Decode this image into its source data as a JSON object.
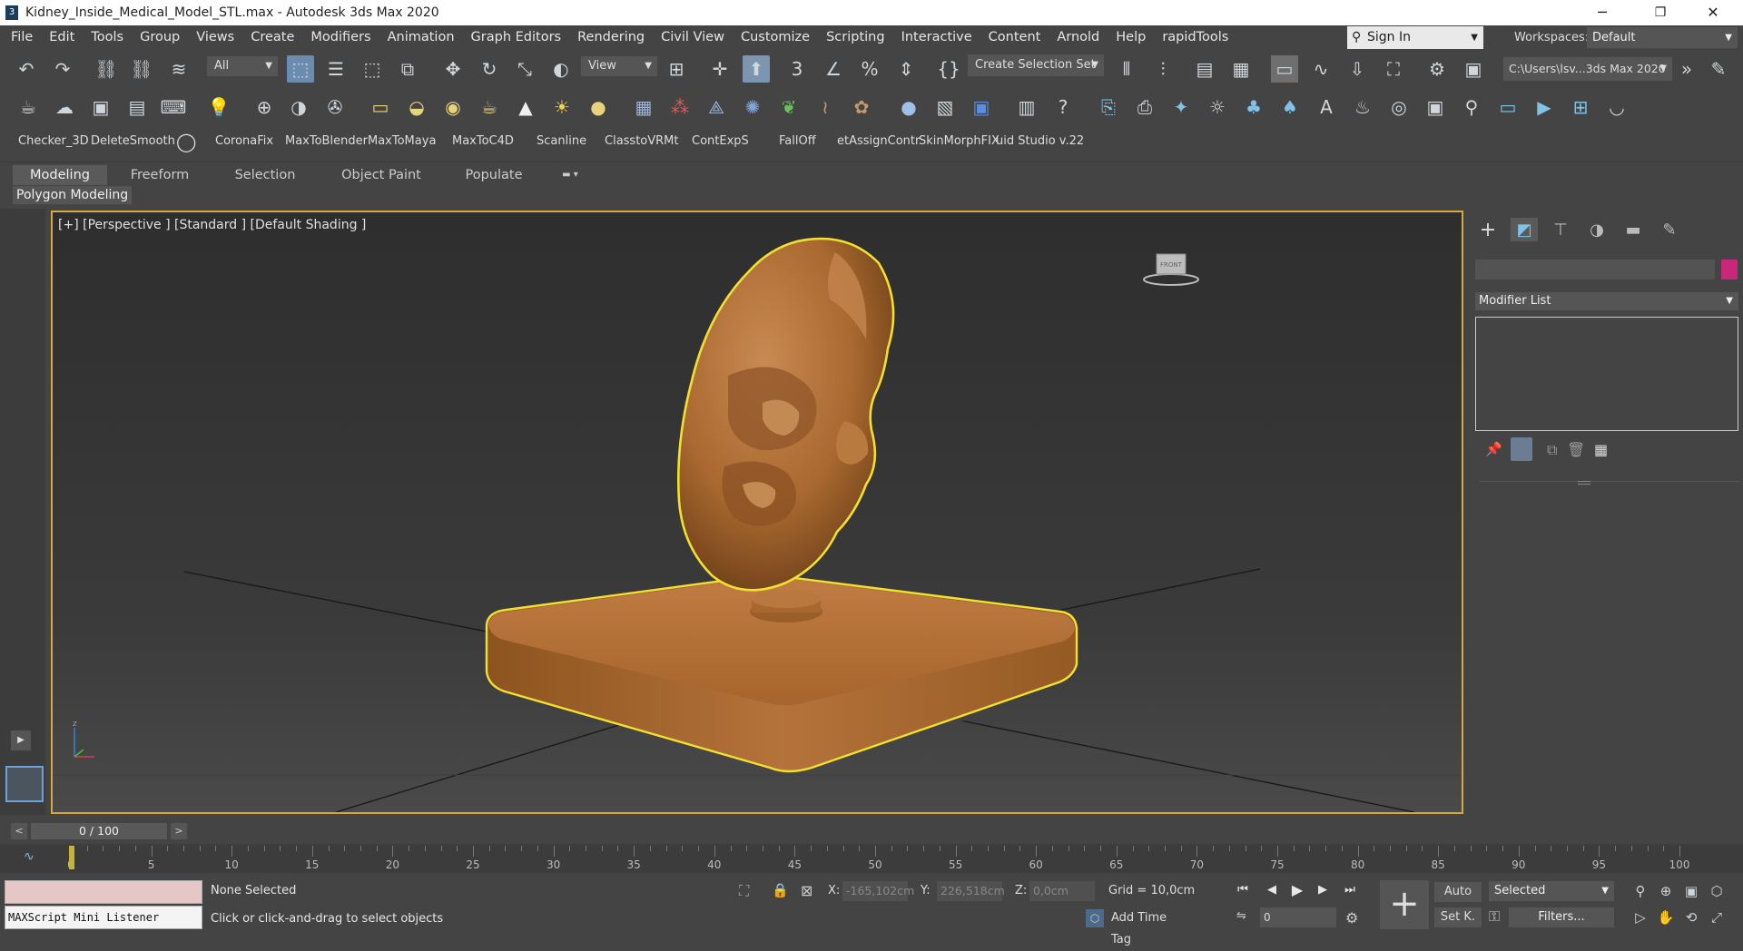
{
  "window": {
    "title": "Kidney_Inside_Medical_Model_STL.max - Autodesk 3ds Max 2020",
    "app_icon": "3",
    "minimize": "─",
    "restore": "❐",
    "close": "✕"
  },
  "menu": [
    "File",
    "Edit",
    "Tools",
    "Group",
    "Views",
    "Create",
    "Modifiers",
    "Animation",
    "Graph Editors",
    "Rendering",
    "Civil View",
    "Customize",
    "Scripting",
    "Interactive",
    "Content",
    "Arnold",
    "Help",
    "rapidTools"
  ],
  "account": {
    "sign_in": "Sign In",
    "workspaces_label": "Workspaces:",
    "workspace": "Default"
  },
  "main_toolbar": {
    "filter": "All",
    "ref_coord": "View",
    "selection_set": "Create Selection Set",
    "project_path": "C:\\Users\\lsv...3ds Max 2020"
  },
  "script_buttons": [
    "Checker_3D",
    "DeleteSmooth",
    "CoronaFix",
    "MaxToBlender",
    "MaxToMaya",
    "MaxToC4D",
    "Scanline",
    "ClasstoVRMt",
    "ContExpS",
    "FallOff",
    "etAssignContr",
    "SkinMorphFIX",
    "uid Studio v.22"
  ],
  "ribbon": {
    "tabs": [
      "Modeling",
      "Freeform",
      "Selection",
      "Object Paint",
      "Populate"
    ],
    "active": "Modeling",
    "panel": "Polygon Modeling"
  },
  "viewport": {
    "label": "[+] [Perspective ] [Standard ] [Default Shading ]",
    "viewcube": "FRONT",
    "axis_z": "z"
  },
  "command_panel": {
    "modifier_list": "Modifier List",
    "color": "#c8277a"
  },
  "time_slider": {
    "frame": "0 / 100",
    "prev": "<",
    "next": ">"
  },
  "track": {
    "ticks": [
      0,
      5,
      10,
      15,
      20,
      25,
      30,
      35,
      40,
      45,
      50,
      55,
      60,
      65,
      70,
      75,
      80,
      85,
      90,
      95,
      100
    ]
  },
  "status": {
    "maxscript": "MAXScript Mini Listener",
    "selection": "None Selected",
    "prompt": "Click or click-and-drag to select objects",
    "x_label": "X:",
    "x": "-165,102cm",
    "y_label": "Y:",
    "y": "226,518cm",
    "z_label": "Z:",
    "z": "0,0cm",
    "grid": "Grid = 10,0cm",
    "add_time_tag": "Add Time Tag",
    "current_frame": "0",
    "auto": "Auto",
    "set_key": "Set K.",
    "key_filter": "Selected",
    "filters": "Filters..."
  },
  "colors": {
    "selection_outline": "#f2e030",
    "model": "#b8743c",
    "viewport_border": "#d6a93a"
  }
}
